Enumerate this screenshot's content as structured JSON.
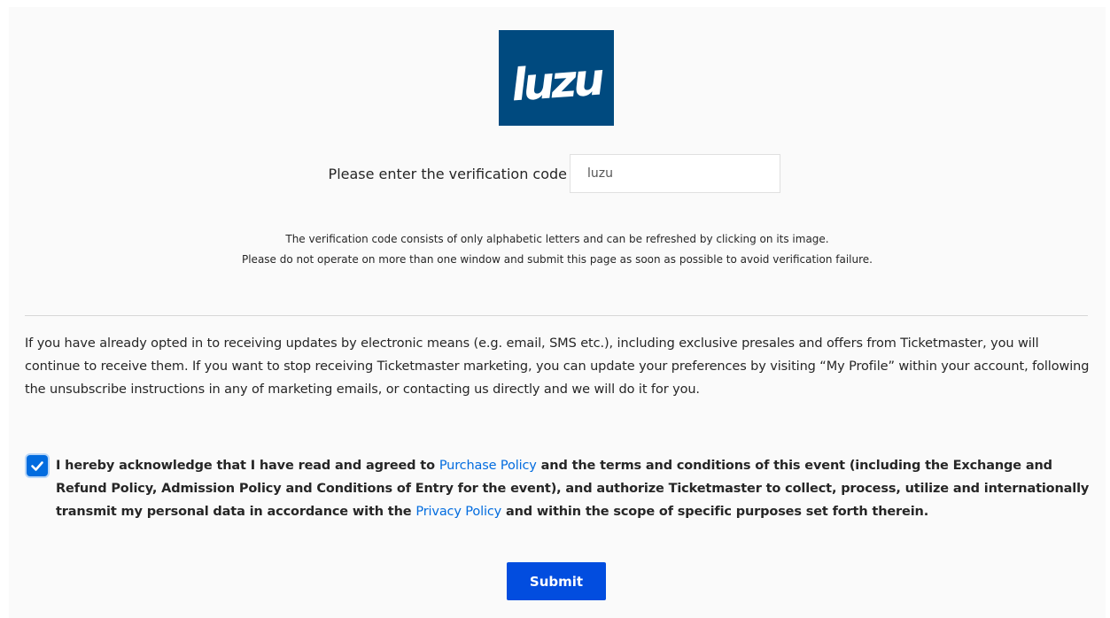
{
  "captcha": {
    "image_text": "luzu",
    "background_color": "#004a7f"
  },
  "verification": {
    "label": "Please enter the verification code",
    "input_value": "luzu",
    "hint_line_1": "The verification code consists of only alphabetic letters and can be refreshed by clicking on its image.",
    "hint_line_2": "Please do not operate on more than one window and submit this page as soon as possible to avoid verification failure."
  },
  "marketing_notice": "If you have already opted in to receiving updates by electronic means (e.g. email, SMS etc.), including exclusive presales and offers from Ticketmaster, you will continue to receive them. If you want to stop receiving Ticketmaster marketing, you can update your preferences by visiting “My Profile” within your account, following the unsubscribe instructions in any of marketing emails, or contacting us directly and we will do it for you.",
  "consent": {
    "checked": true,
    "text_part_1": "I hereby acknowledge that I have read and agreed to ",
    "purchase_policy_link": "Purchase Policy",
    "text_part_2": " and the terms and conditions of this event (including the Exchange and Refund Policy, Admission Policy and Conditions of Entry for the event), and authorize Ticketmaster to collect, process, utilize and internationally transmit my personal data in accordance with the ",
    "privacy_policy_link": "Privacy Policy",
    "text_part_3": " and within the scope of specific purposes set forth therein."
  },
  "submit_label": "Submit",
  "colors": {
    "accent": "#026cdf",
    "button": "#024ddf",
    "text": "#262626",
    "page_background": "#fafafa"
  }
}
